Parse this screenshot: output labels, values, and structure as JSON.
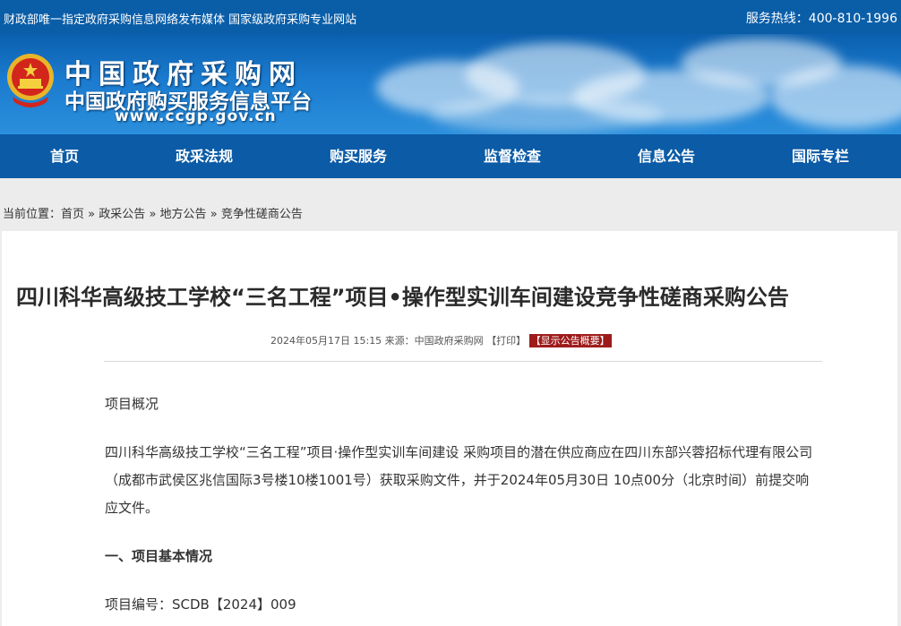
{
  "topbar": {
    "left_text": "财政部唯一指定政府采购信息网络发布媒体 国家级政府采购专业网站",
    "hotline": "服务热线：400-810-1996"
  },
  "header": {
    "title": "中国政府采购网",
    "subtitle": "中国政府购买服务信息平台",
    "url": "www.ccgp.gov.cn"
  },
  "nav": {
    "items": [
      {
        "label": "首页"
      },
      {
        "label": "政采法规"
      },
      {
        "label": "购买服务"
      },
      {
        "label": "监督检查"
      },
      {
        "label": "信息公告"
      },
      {
        "label": "国际专栏"
      }
    ]
  },
  "breadcrumb": {
    "prefix": "当前位置：",
    "items": [
      "首页",
      "政采公告",
      "地方公告",
      "竞争性磋商公告"
    ],
    "separator": "»"
  },
  "article": {
    "title": "四川科华高级技工学校“三名工程”项目•操作型实训车间建设竞争性磋商采购公告",
    "meta": "2024年05月17日 15:15 来源：中国政府采购网",
    "print_label": "【打印】",
    "summary_label": "【显示公告概要】",
    "overview_heading": "项目概况",
    "intro": "四川科华高级技工学校“三名工程”项目·操作型实训车间建设 采购项目的潜在供应商应在四川东部兴蓉招标代理有限公司（成都市武侯区兆信国际3号楼10楼1001号）获取采购文件，并于2024年05月30日 10点00分（北京时间）前提交响应文件。",
    "section1_heading": "一、项目基本情况",
    "project_no": "项目编号：SCDB【2024】009"
  },
  "colors": {
    "nav_bg": "#0b5ba6",
    "topbar_bg": "#0a5ea8",
    "summary_btn": "#9e1b1b"
  }
}
